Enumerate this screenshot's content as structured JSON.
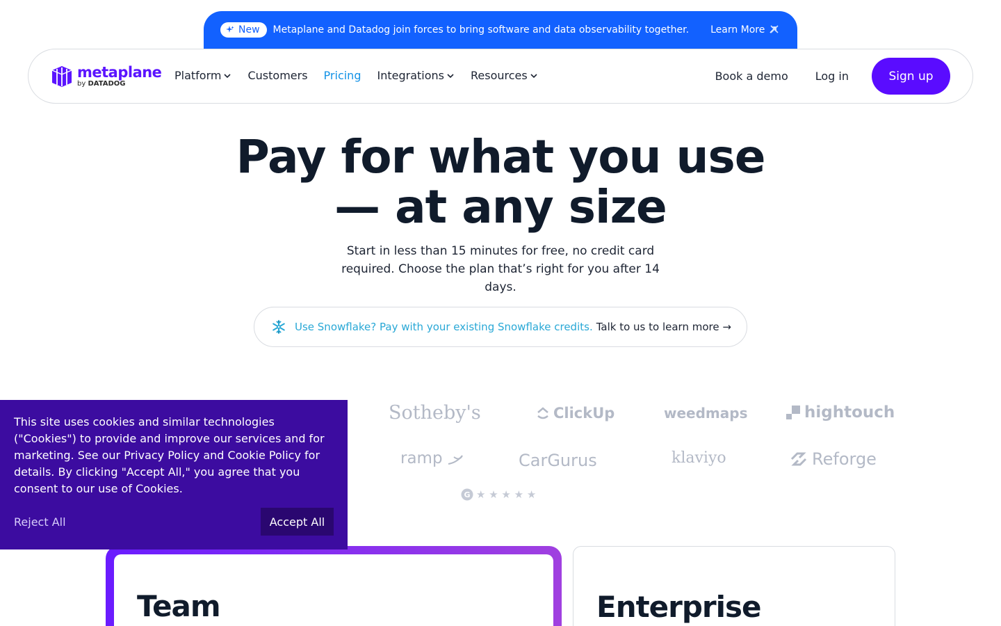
{
  "announcement": {
    "badge": "New",
    "message": "Metaplane and Datadog join forces to bring software and data observability together.",
    "cta": "Learn More",
    "bg_color": "#1261ff"
  },
  "nav": {
    "brand": "metaplane",
    "brand_by": "by",
    "brand_parent": "DATADOG",
    "links": [
      {
        "label": "Platform",
        "dropdown": true
      },
      {
        "label": "Customers",
        "dropdown": false
      },
      {
        "label": "Pricing",
        "dropdown": false,
        "active": true
      },
      {
        "label": "Integrations",
        "dropdown": true
      },
      {
        "label": "Resources",
        "dropdown": true
      }
    ],
    "book_demo": "Book a demo",
    "login": "Log in",
    "signup": "Sign up",
    "accent_color": "#5a0cff"
  },
  "hero": {
    "title_line1": "Pay for what you use",
    "title_line2": "— at any size",
    "subtitle": "Start in less than 15 minutes for free, no credit card required.  Choose the plan that’s right for you after 14 days.",
    "snowflake_link": "Use Snowflake? Pay with your existing Snowflake credits.",
    "snowflake_cta": "Talk to us to learn more →"
  },
  "customer_logos": [
    "Sotheby's",
    "ClickUp",
    "weedmaps",
    "hightouch",
    "ramp",
    "CarGurus",
    "klaviyo",
    "Reforge"
  ],
  "rating": {
    "stars": 5,
    "source_icon": "g2-icon"
  },
  "cookie": {
    "text": "This site uses cookies and similar technologies (\"Cookies\") to provide and improve our services and for marketing. See our Privacy Policy and Cookie Policy for details. By clicking \"Accept All,\" you agree that you consent to our use of Cookies.",
    "reject": "Reject All",
    "accept": "Accept All"
  },
  "plans": [
    {
      "name": "Team"
    },
    {
      "name": "Enterprise"
    }
  ]
}
